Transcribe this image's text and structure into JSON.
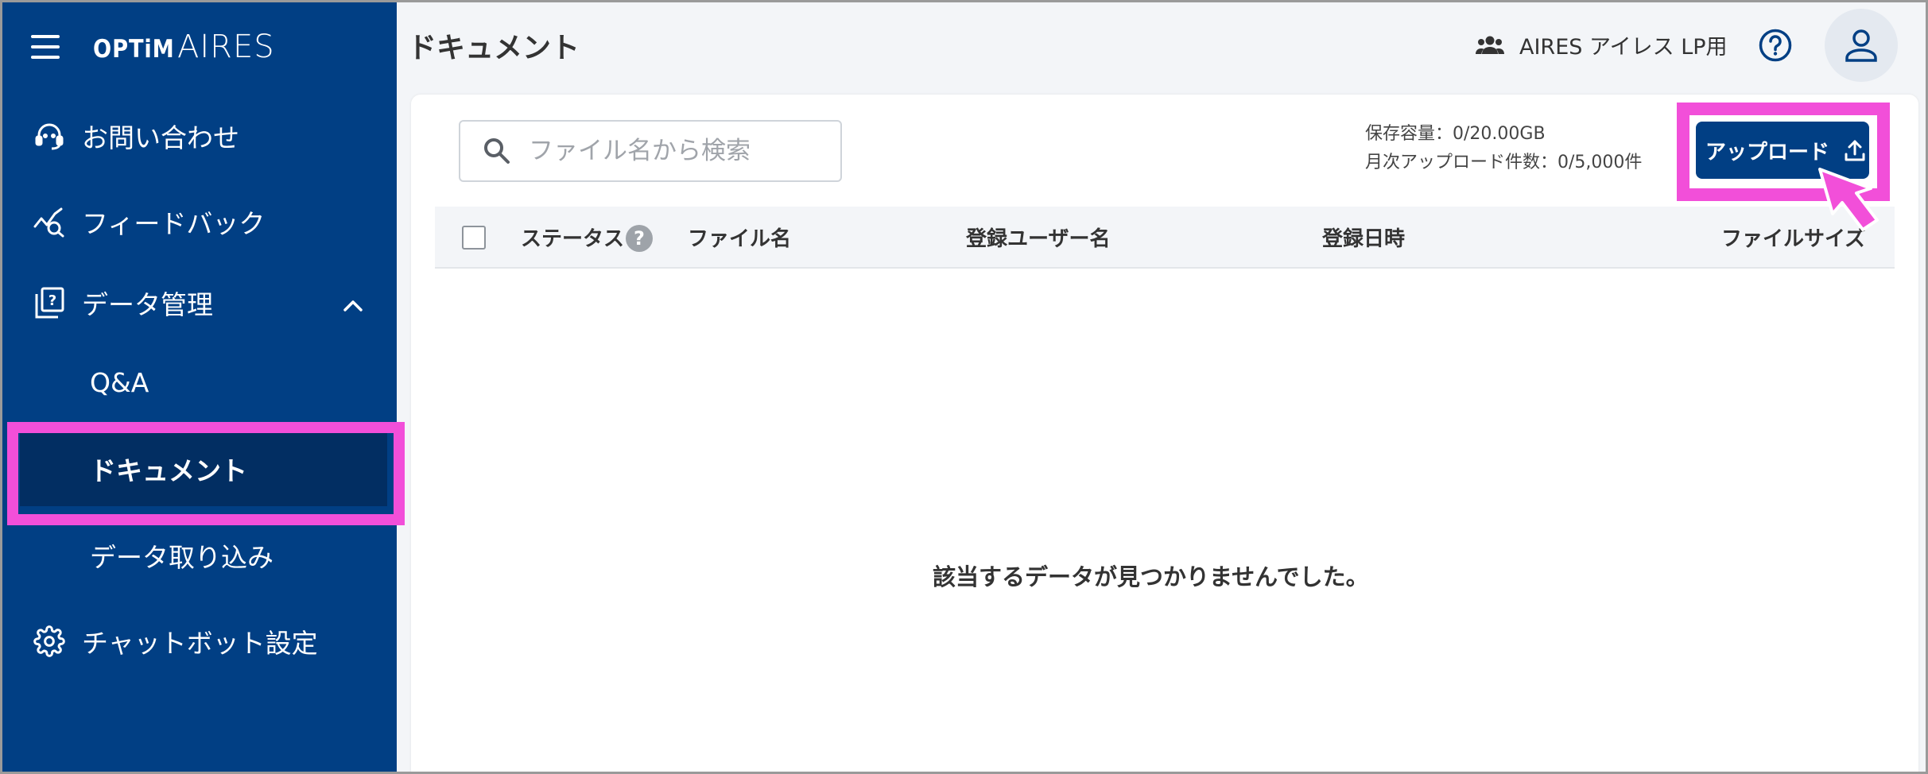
{
  "app": {
    "logo_brand": "OPTiM",
    "logo_product": "AIRES"
  },
  "sidebar": {
    "items": [
      {
        "label": "お問い合わせ",
        "icon": "support-agent-icon"
      },
      {
        "label": "フィードバック",
        "icon": "feedback-chart-icon"
      },
      {
        "label": "データ管理",
        "icon": "data-management-icon",
        "expanded": true
      },
      {
        "label": "Q&A"
      },
      {
        "label": "ドキュメント",
        "active": true
      },
      {
        "label": "データ取り込み"
      },
      {
        "label": "チャットボット設定",
        "icon": "gear-icon"
      }
    ]
  },
  "header": {
    "title": "ドキュメント",
    "tenant": "AIRES アイレス LP用"
  },
  "toolbar": {
    "search_placeholder": "ファイル名から検索",
    "storage_capacity": "保存容量：0/20.00GB",
    "monthly_uploads": "月次アップロード件数：0/5,000件",
    "upload_label": "アップロード"
  },
  "table": {
    "columns": [
      "ステータス",
      "ファイル名",
      "登録ユーザー名",
      "登録日時",
      "ファイルサイズ"
    ],
    "rows": [],
    "empty_message": "該当するデータが見つかりませんでした。"
  },
  "colors": {
    "sidebar_bg": "#013f84",
    "sidebar_active": "#022e62",
    "highlight": "#f24fd9",
    "page_bg": "#f3f5f8"
  }
}
